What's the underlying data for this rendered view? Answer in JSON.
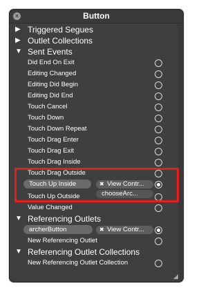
{
  "window": {
    "title": "Button"
  },
  "sections": {
    "triggered_segues": "Triggered Segues",
    "outlet_collections": "Outlet Collections",
    "sent_events": "Sent Events",
    "referencing_outlets": "Referencing Outlets",
    "referencing_outlet_collections": "Referencing Outlet Collections"
  },
  "events": [
    "Did End On Exit",
    "Editing Changed",
    "Editing Did Begin",
    "Editing Did End",
    "Touch Cancel",
    "Touch Down",
    "Touch Down Repeat",
    "Touch Drag Enter",
    "Touch Drag Exit",
    "Touch Drag Inside",
    "Touch Drag Outside",
    "Touch Up Inside",
    "Touch Up Outside",
    "Value Changed"
  ],
  "touch_up_inside_connection": {
    "target": "View Contr...",
    "action": "chooseArc...",
    "remove_glyph": "✖"
  },
  "referencing": {
    "outlet_name": "archerButton",
    "target": "View Contr...",
    "remove_glyph": "✖",
    "new_outlet": "New Referencing Outlet",
    "new_outlet_collection": "New Referencing Outlet Collection"
  },
  "icons": {
    "close": "x-icon",
    "triangle_right": "▶",
    "triangle_down": "▼"
  },
  "colors": {
    "panel": "#3f3f3f",
    "highlight": "#e3201f"
  }
}
